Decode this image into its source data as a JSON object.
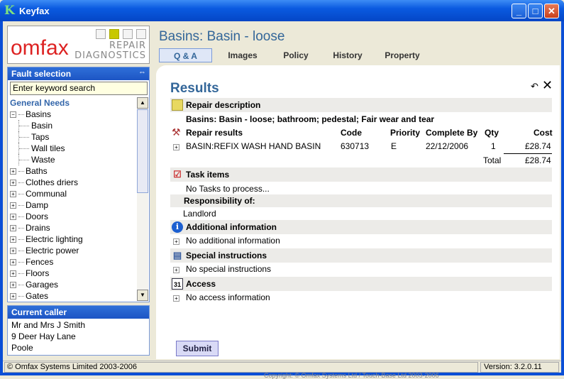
{
  "window": {
    "title": "Keyfax",
    "icon": "K",
    "min": "_",
    "max": "□",
    "close": "✕"
  },
  "logo": {
    "brand": "omfax",
    "line1": "REPAIR",
    "line2": "DIAGNOSTICS"
  },
  "fault_selection": {
    "title": "Fault selection",
    "search_value": "Enter keyword search",
    "category": "General Needs",
    "items": [
      {
        "label": "Basins",
        "expanded": true
      },
      {
        "label": "Basin",
        "child": true
      },
      {
        "label": "Taps",
        "child": true
      },
      {
        "label": "Wall tiles",
        "child": true
      },
      {
        "label": "Waste",
        "child": true
      },
      {
        "label": "Baths"
      },
      {
        "label": "Clothes driers"
      },
      {
        "label": "Communal"
      },
      {
        "label": "Damp"
      },
      {
        "label": "Doors"
      },
      {
        "label": "Drains"
      },
      {
        "label": "Electric lighting"
      },
      {
        "label": "Electric power"
      },
      {
        "label": "Fences"
      },
      {
        "label": "Floors"
      },
      {
        "label": "Garages"
      },
      {
        "label": "Gates"
      }
    ]
  },
  "current_caller": {
    "title": "Current caller",
    "lines": [
      "Mr and Mrs J Smith",
      "9 Deer Hay Lane",
      "Poole"
    ]
  },
  "page_title": "Basins: Basin - loose",
  "tabs": [
    {
      "label": "Q & A",
      "active": true
    },
    {
      "label": "Images"
    },
    {
      "label": "Policy"
    },
    {
      "label": "History"
    },
    {
      "label": "Property"
    }
  ],
  "results": {
    "heading": "Results",
    "repair_description_label": "Repair description",
    "repair_description": "Basins: Basin - loose; bathroom; pedestal; Fair wear and tear",
    "repair_results_label": "Repair results",
    "columns": {
      "code": "Code",
      "priority": "Priority",
      "complete_by": "Complete By",
      "qty": "Qty",
      "cost": "Cost"
    },
    "row": {
      "desc": "BASIN:REFIX WASH HAND BASIN",
      "code": "630713",
      "priority": "E",
      "complete_by": "22/12/2006",
      "qty": "1",
      "cost": "£28.74"
    },
    "total_label": "Total",
    "total": "£28.74",
    "task_items_label": "Task items",
    "task_items": "No Tasks to process...",
    "responsibility_label": "Responsibility of:",
    "responsibility": "Landlord",
    "additional_label": "Additional information",
    "additional": "No additional information",
    "special_label": "Special instructions",
    "special": "No special instructions",
    "access_label": "Access",
    "access": "No access information",
    "calendar_icon_text": "31"
  },
  "submit_label": "Submit",
  "copyright": "Copyright: © Omfax Systems Ltd / Touch-Base Ltd 2003-2006",
  "status": {
    "left": "© Omfax Systems Limited 2003-2006",
    "right": "Version: 3.2.0.11"
  }
}
